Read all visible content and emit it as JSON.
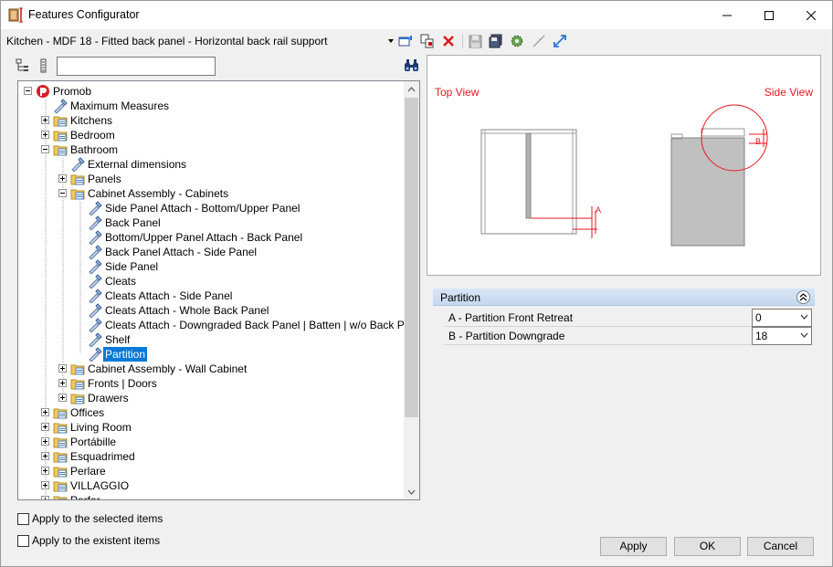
{
  "window": {
    "title": "Features Configurator"
  },
  "toolbar": {
    "configuration": "Kitchen - MDF 18 - Fitted back panel - Horizontal back rail support"
  },
  "search": {
    "value": ""
  },
  "tree": {
    "nodes": [
      {
        "label": "Promob"
      },
      {
        "label": "Maximum Measures"
      },
      {
        "label": "Kitchens"
      },
      {
        "label": "Bedroom"
      },
      {
        "label": "Bathroom"
      },
      {
        "label": "External dimensions"
      },
      {
        "label": "Panels"
      },
      {
        "label": "Cabinet Assembly - Cabinets"
      },
      {
        "label": "Side Panel Attach - Bottom/Upper Panel"
      },
      {
        "label": "Back Panel"
      },
      {
        "label": " Bottom/Upper Panel Attach - Back Panel"
      },
      {
        "label": "Back Panel Attach - Side Panel"
      },
      {
        "label": "Side Panel"
      },
      {
        "label": "Cleats"
      },
      {
        "label": "Cleats Attach - Side Panel"
      },
      {
        "label": "Cleats Attach - Whole Back Panel"
      },
      {
        "label": "Cleats Attach - Downgraded Back Panel | Batten | w/o Back Panel"
      },
      {
        "label": "Shelf"
      },
      {
        "label": "Partition"
      },
      {
        "label": "Cabinet Assembly - Wall Cabinet"
      },
      {
        "label": "Fronts | Doors"
      },
      {
        "label": "Drawers"
      },
      {
        "label": "Offices"
      },
      {
        "label": "Living Room"
      },
      {
        "label": "Portábille"
      },
      {
        "label": "Esquadrimed"
      },
      {
        "label": "Perlare"
      },
      {
        "label": "VILLAGGIO"
      },
      {
        "label": "Porfar"
      }
    ],
    "selected": "Partition"
  },
  "options": {
    "apply_selected": "Apply to the selected items",
    "apply_existent": "Apply to the existent items"
  },
  "preview": {
    "top_view_label": "Top View",
    "side_view_label": "Side View",
    "marker_a": "A",
    "marker_b": "B",
    "accent_color": "#e8171f"
  },
  "properties": {
    "group": "Partition",
    "rows": [
      {
        "name": "A - Partition Front Retreat",
        "value": "0"
      },
      {
        "name": "B - Partition Downgrade",
        "value": "18"
      }
    ]
  },
  "buttons": {
    "apply": "Apply",
    "ok": "OK",
    "cancel": "Cancel"
  }
}
